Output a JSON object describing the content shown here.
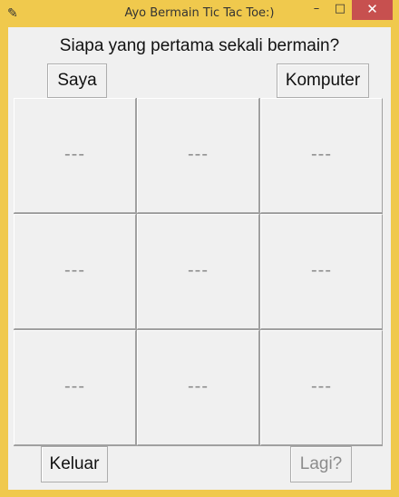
{
  "window": {
    "title": "Ayo Bermain Tic Tac Toe:)",
    "controls": {
      "minimize": "–",
      "maximize": "□",
      "close": "✕"
    }
  },
  "prompt": "Siapa yang pertama sekali bermain?",
  "buttons": {
    "me": "Saya",
    "computer": "Komputer",
    "quit": "Keluar",
    "again": "Lagi?"
  },
  "board": [
    "---",
    "---",
    "---",
    "---",
    "---",
    "---",
    "---",
    "---",
    "---"
  ],
  "colors": {
    "titlebar": "#f0c94d",
    "close": "#c7504f",
    "surface": "#f0f0f0",
    "disabled_text": "#8c8c8c"
  }
}
